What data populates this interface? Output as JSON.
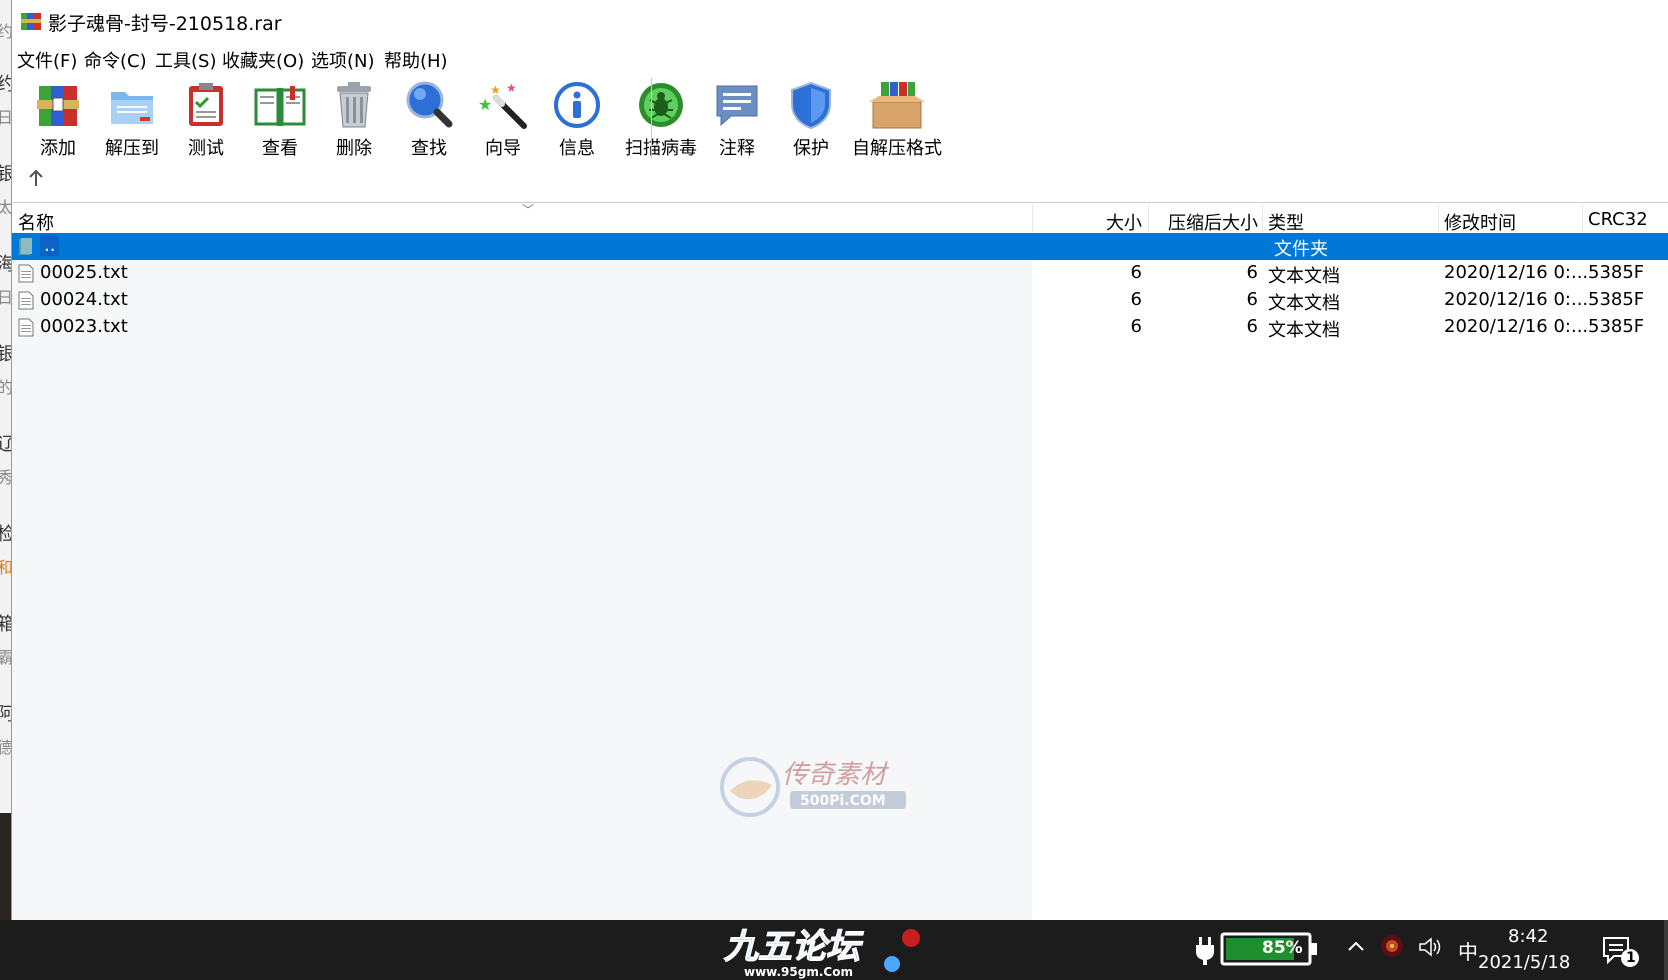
{
  "window": {
    "title": "影子魂骨-封号-210518.rar"
  },
  "menu": [
    "文件(F)",
    "命令(C)",
    "工具(S)",
    "收藏夹(O)",
    "选项(N)",
    "帮助(H)"
  ],
  "toolbar": [
    {
      "label": "添加",
      "icon": "add-archive-icon"
    },
    {
      "label": "解压到",
      "icon": "extract-folder-icon"
    },
    {
      "label": "测试",
      "icon": "test-clipboard-icon"
    },
    {
      "label": "查看",
      "icon": "view-book-icon"
    },
    {
      "label": "删除",
      "icon": "trash-icon"
    },
    {
      "label": "查找",
      "icon": "magnifier-icon"
    },
    {
      "label": "向导",
      "icon": "wizard-wand-icon"
    },
    {
      "label": "信息",
      "icon": "info-icon"
    },
    {
      "label": "扫描病毒",
      "icon": "virus-scan-icon"
    },
    {
      "label": "注释",
      "icon": "comment-icon"
    },
    {
      "label": "保护",
      "icon": "shield-icon"
    },
    {
      "label": "自解压格式",
      "icon": "sfx-box-icon"
    }
  ],
  "columns": {
    "name": "名称",
    "size": "大小",
    "packed": "压缩后大小",
    "type": "类型",
    "modified": "修改时间",
    "crc": "CRC32"
  },
  "rows": [
    {
      "name": "..",
      "size": "",
      "packed": "",
      "type": "文件夹",
      "modified": "",
      "crc": ""
    },
    {
      "name": "00025.txt",
      "size": "6",
      "packed": "6",
      "type": "文本文档",
      "modified": "2020/12/16 0:...",
      "crc": "5385F"
    },
    {
      "name": "00024.txt",
      "size": "6",
      "packed": "6",
      "type": "文本文档",
      "modified": "2020/12/16 0:...",
      "crc": "5385F"
    },
    {
      "name": "00023.txt",
      "size": "6",
      "packed": "6",
      "type": "文本文档",
      "modified": "2020/12/16 0:...",
      "crc": "5385F"
    }
  ],
  "watermark": {
    "top": "传奇素材",
    "bottom": "500Pi.COM"
  },
  "taskbar": {
    "logo_text": "九五论坛",
    "logo_url": "www.95gm.Com",
    "battery": "85%",
    "ime": "中",
    "time": "8:42",
    "date": "2021/5/18",
    "notifications": "1"
  },
  "background_glyphs": [
    "约",
    "日",
    "银",
    "太",
    "海",
    "日",
    "银",
    "的",
    "辽",
    "秀",
    "检",
    "和",
    "箱",
    "霸",
    "阿",
    "德"
  ]
}
